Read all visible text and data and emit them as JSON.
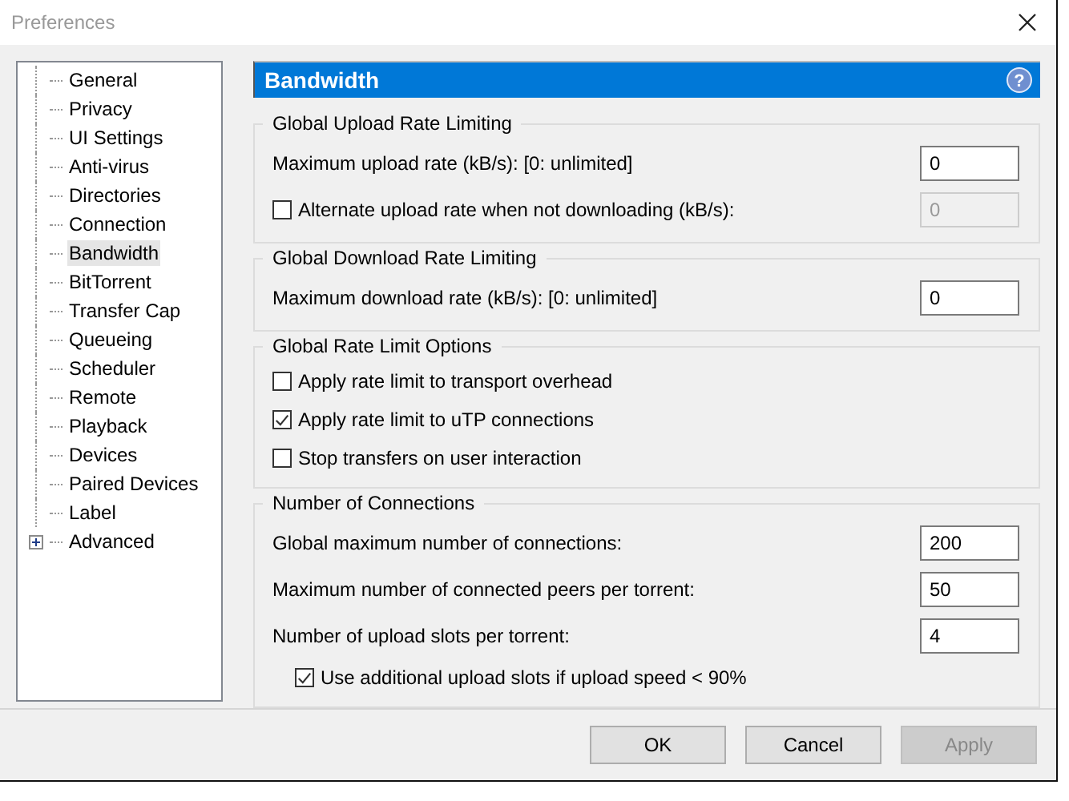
{
  "window": {
    "title": "Preferences"
  },
  "tree": [
    {
      "label": "General",
      "selected": false
    },
    {
      "label": "Privacy",
      "selected": false
    },
    {
      "label": "UI Settings",
      "selected": false
    },
    {
      "label": "Anti-virus",
      "selected": false
    },
    {
      "label": "Directories",
      "selected": false
    },
    {
      "label": "Connection",
      "selected": false
    },
    {
      "label": "Bandwidth",
      "selected": true
    },
    {
      "label": "BitTorrent",
      "selected": false
    },
    {
      "label": "Transfer Cap",
      "selected": false
    },
    {
      "label": "Queueing",
      "selected": false
    },
    {
      "label": "Scheduler",
      "selected": false
    },
    {
      "label": "Remote",
      "selected": false
    },
    {
      "label": "Playback",
      "selected": false
    },
    {
      "label": "Devices",
      "selected": false
    },
    {
      "label": "Paired Devices",
      "selected": false
    },
    {
      "label": "Label",
      "selected": false
    },
    {
      "label": "Advanced",
      "selected": false,
      "expandable": true,
      "expanded": false
    }
  ],
  "header": {
    "title": "Bandwidth",
    "help": "?"
  },
  "groups": [
    {
      "title": "Global Upload Rate Limiting",
      "rows": [
        {
          "kind": "field",
          "label": "Maximum upload rate (kB/s): [0: unlimited]",
          "value": "0",
          "disabled": false
        },
        {
          "kind": "checkfield",
          "label": "Alternate upload rate when not downloading (kB/s):",
          "checked": false,
          "value": "0",
          "disabled": true
        }
      ]
    },
    {
      "title": "Global Download Rate Limiting",
      "rows": [
        {
          "kind": "field",
          "label": "Maximum download rate (kB/s): [0: unlimited]",
          "value": "0",
          "disabled": false
        }
      ]
    },
    {
      "title": "Global Rate Limit Options",
      "rows": [
        {
          "kind": "check",
          "label": "Apply rate limit to transport overhead",
          "checked": false,
          "indented": false
        },
        {
          "kind": "check",
          "label": "Apply rate limit to uTP connections",
          "checked": true,
          "indented": false
        },
        {
          "kind": "check",
          "label": "Stop transfers on user interaction",
          "checked": false,
          "indented": false
        }
      ]
    },
    {
      "title": "Number of Connections",
      "rows": [
        {
          "kind": "field",
          "label": "Global maximum number of connections:",
          "value": "200",
          "disabled": false
        },
        {
          "kind": "field",
          "label": "Maximum number of connected peers per torrent:",
          "value": "50",
          "disabled": false
        },
        {
          "kind": "field",
          "label": "Number of upload slots per torrent:",
          "value": "4",
          "disabled": false
        },
        {
          "kind": "check",
          "label": "Use additional upload slots if upload speed < 90%",
          "checked": true,
          "indented": true
        }
      ]
    }
  ],
  "buttons": [
    {
      "label": "OK",
      "disabled": false
    },
    {
      "label": "Cancel",
      "disabled": false
    },
    {
      "label": "Apply",
      "disabled": true
    }
  ]
}
